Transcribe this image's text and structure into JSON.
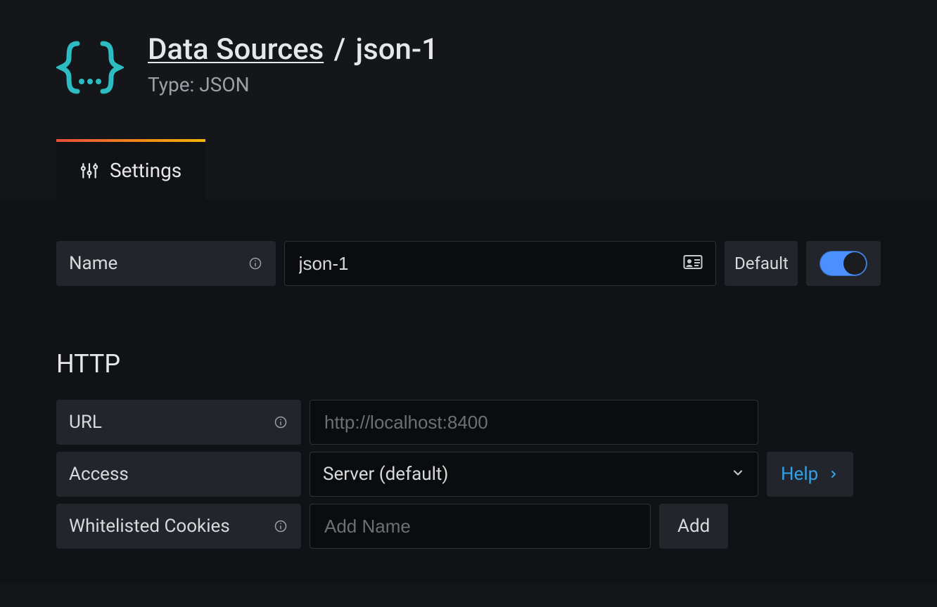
{
  "header": {
    "breadcrumb_root": "Data Sources",
    "breadcrumb_sep": "/",
    "breadcrumb_current": "json-1",
    "subtitle": "Type: JSON"
  },
  "tabs": {
    "settings": "Settings"
  },
  "form": {
    "name_label": "Name",
    "name_value": "json-1",
    "default_label": "Default",
    "default_on": true
  },
  "http": {
    "section_title": "HTTP",
    "url_label": "URL",
    "url_placeholder": "http://localhost:8400",
    "url_value": "",
    "access_label": "Access",
    "access_value": "Server (default)",
    "help_label": "Help",
    "cookies_label": "Whitelisted Cookies",
    "cookies_placeholder": "Add Name",
    "cookies_value": "",
    "add_button": "Add"
  }
}
